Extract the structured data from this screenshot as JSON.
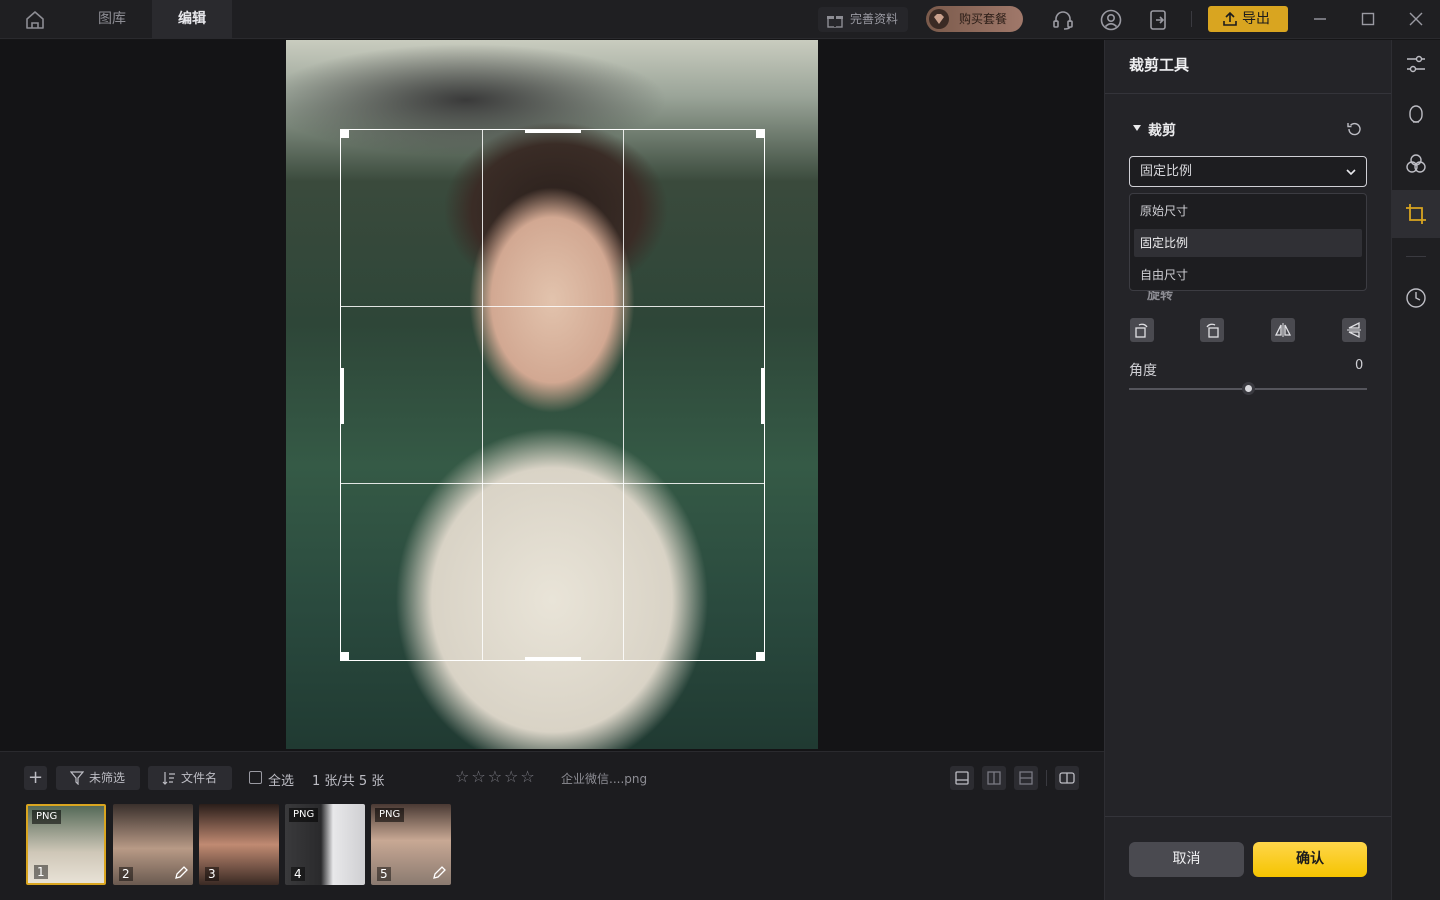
{
  "titlebar": {
    "tabs": [
      {
        "label": "图库",
        "active": false
      },
      {
        "label": "编辑",
        "active": true
      }
    ],
    "complete_profile": "完善资料",
    "buy_package": "购买套餐",
    "export": "导出"
  },
  "canvas": {
    "crop_grid": "rule-of-thirds"
  },
  "filmstrip": {
    "add": "+",
    "filter": "未筛选",
    "sort": "文件名",
    "select_all": "全选",
    "count": "1 张/共 5 张",
    "rating": "☆☆☆☆☆",
    "filename": "企业微信....png",
    "thumbs": [
      {
        "tag": "PNG",
        "num": "1",
        "selected": true,
        "edited": false
      },
      {
        "tag": "",
        "num": "2",
        "selected": false,
        "edited": true
      },
      {
        "tag": "",
        "num": "3",
        "selected": false,
        "edited": false
      },
      {
        "tag": "PNG",
        "num": "4",
        "selected": false,
        "edited": false
      },
      {
        "tag": "PNG",
        "num": "5",
        "selected": false,
        "edited": true
      }
    ]
  },
  "panel": {
    "title": "裁剪工具",
    "section": "裁剪",
    "select_value": "固定比例",
    "options": [
      "原始尺寸",
      "固定比例",
      "自由尺寸"
    ],
    "rotate_label": "旋转",
    "angle_label": "角度",
    "angle_value": "0",
    "cancel": "取消",
    "confirm": "确认"
  },
  "colors": {
    "accent": "#d9a520",
    "confirm": "#f5c400"
  }
}
